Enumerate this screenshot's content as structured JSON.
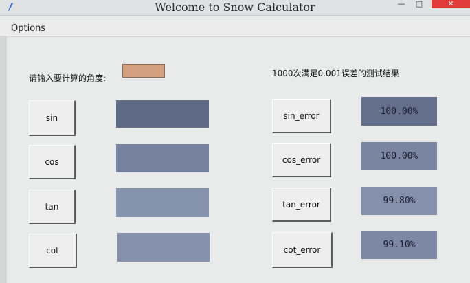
{
  "window": {
    "title": "Welcome to Snow Calculator",
    "minimize_glyph": "—",
    "maximize_glyph": "□",
    "close_glyph": "✕"
  },
  "menu": {
    "options_label": "Options"
  },
  "input": {
    "angle_label": "请输入要计算的角度:",
    "angle_value": "",
    "field_color": "#d2a07e"
  },
  "results": {
    "title": "1000次满足0.001误差的测试结果"
  },
  "functions": [
    {
      "label": "sin",
      "value": ""
    },
    {
      "label": "cos",
      "value": ""
    },
    {
      "label": "tan",
      "value": ""
    },
    {
      "label": "cot",
      "value": ""
    }
  ],
  "errors": [
    {
      "label": "sin_error",
      "value": "100.00%"
    },
    {
      "label": "cos_error",
      "value": "100.00%"
    },
    {
      "label": "tan_error",
      "value": "99.80%"
    },
    {
      "label": "cot_error",
      "value": "99.10%"
    }
  ],
  "colors": {
    "output_box": "#7f8aa3",
    "close_button": "#e03a3a"
  }
}
